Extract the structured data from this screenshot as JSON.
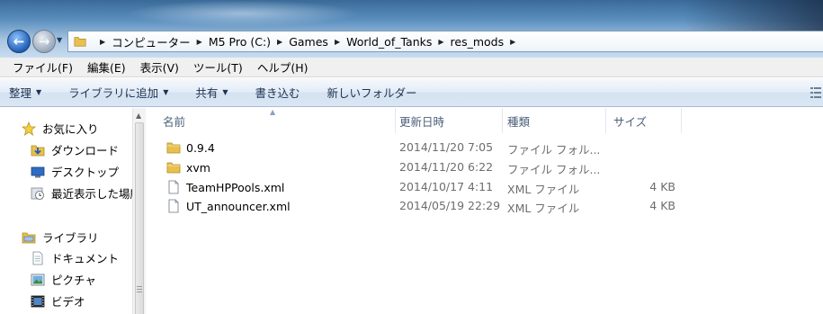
{
  "address": {
    "crumbs": [
      "コンピューター",
      "M5 Pro (C:)",
      "Games",
      "World_of_Tanks",
      "res_mods"
    ]
  },
  "menu": {
    "items": [
      "ファイル(F)",
      "編集(E)",
      "表示(V)",
      "ツール(T)",
      "ヘルプ(H)"
    ]
  },
  "toolbar": {
    "organize": "整理",
    "include_library": "ライブラリに追加",
    "share": "共有",
    "burn": "書き込む",
    "new_folder": "新しいフォルダー"
  },
  "nav": {
    "favorites": "お気に入り",
    "downloads": "ダウンロード",
    "desktop": "デスクトップ",
    "recent": "最近表示した場所",
    "libraries": "ライブラリ",
    "documents": "ドキュメント",
    "pictures": "ピクチャ",
    "videos": "ビデオ"
  },
  "columns": {
    "name": "名前",
    "date": "更新日時",
    "type": "種類",
    "size": "サイズ"
  },
  "files": [
    {
      "name": "0.9.4",
      "date": "2014/11/20 7:05",
      "type": "ファイル フォル...",
      "size": "",
      "icon": "folder-icon"
    },
    {
      "name": "xvm",
      "date": "2014/11/20 6:22",
      "type": "ファイル フォル...",
      "size": "",
      "icon": "folder-icon"
    },
    {
      "name": "TeamHPPools.xml",
      "date": "2014/10/17 4:11",
      "type": "XML ファイル",
      "size": "4 KB",
      "icon": "xml-file-icon"
    },
    {
      "name": "UT_announcer.xml",
      "date": "2014/05/19 22:29",
      "type": "XML ファイル",
      "size": "4 KB",
      "icon": "xml-file-icon"
    }
  ],
  "colors": {
    "accent": "#1f5fb5",
    "folder": "#e8c04e",
    "header_text": "#4c607a"
  }
}
